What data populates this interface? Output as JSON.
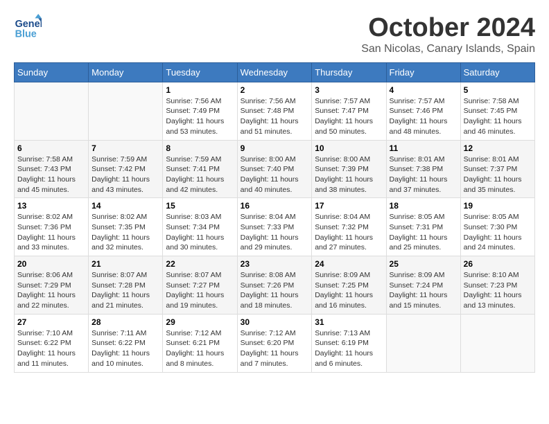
{
  "header": {
    "logo_line1": "General",
    "logo_line2": "Blue",
    "month": "October 2024",
    "location": "San Nicolas, Canary Islands, Spain"
  },
  "days_of_week": [
    "Sunday",
    "Monday",
    "Tuesday",
    "Wednesday",
    "Thursday",
    "Friday",
    "Saturday"
  ],
  "weeks": [
    [
      {
        "num": "",
        "info": ""
      },
      {
        "num": "",
        "info": ""
      },
      {
        "num": "1",
        "info": "Sunrise: 7:56 AM\nSunset: 7:49 PM\nDaylight: 11 hours and 53 minutes."
      },
      {
        "num": "2",
        "info": "Sunrise: 7:56 AM\nSunset: 7:48 PM\nDaylight: 11 hours and 51 minutes."
      },
      {
        "num": "3",
        "info": "Sunrise: 7:57 AM\nSunset: 7:47 PM\nDaylight: 11 hours and 50 minutes."
      },
      {
        "num": "4",
        "info": "Sunrise: 7:57 AM\nSunset: 7:46 PM\nDaylight: 11 hours and 48 minutes."
      },
      {
        "num": "5",
        "info": "Sunrise: 7:58 AM\nSunset: 7:45 PM\nDaylight: 11 hours and 46 minutes."
      }
    ],
    [
      {
        "num": "6",
        "info": "Sunrise: 7:58 AM\nSunset: 7:43 PM\nDaylight: 11 hours and 45 minutes."
      },
      {
        "num": "7",
        "info": "Sunrise: 7:59 AM\nSunset: 7:42 PM\nDaylight: 11 hours and 43 minutes."
      },
      {
        "num": "8",
        "info": "Sunrise: 7:59 AM\nSunset: 7:41 PM\nDaylight: 11 hours and 42 minutes."
      },
      {
        "num": "9",
        "info": "Sunrise: 8:00 AM\nSunset: 7:40 PM\nDaylight: 11 hours and 40 minutes."
      },
      {
        "num": "10",
        "info": "Sunrise: 8:00 AM\nSunset: 7:39 PM\nDaylight: 11 hours and 38 minutes."
      },
      {
        "num": "11",
        "info": "Sunrise: 8:01 AM\nSunset: 7:38 PM\nDaylight: 11 hours and 37 minutes."
      },
      {
        "num": "12",
        "info": "Sunrise: 8:01 AM\nSunset: 7:37 PM\nDaylight: 11 hours and 35 minutes."
      }
    ],
    [
      {
        "num": "13",
        "info": "Sunrise: 8:02 AM\nSunset: 7:36 PM\nDaylight: 11 hours and 33 minutes."
      },
      {
        "num": "14",
        "info": "Sunrise: 8:02 AM\nSunset: 7:35 PM\nDaylight: 11 hours and 32 minutes."
      },
      {
        "num": "15",
        "info": "Sunrise: 8:03 AM\nSunset: 7:34 PM\nDaylight: 11 hours and 30 minutes."
      },
      {
        "num": "16",
        "info": "Sunrise: 8:04 AM\nSunset: 7:33 PM\nDaylight: 11 hours and 29 minutes."
      },
      {
        "num": "17",
        "info": "Sunrise: 8:04 AM\nSunset: 7:32 PM\nDaylight: 11 hours and 27 minutes."
      },
      {
        "num": "18",
        "info": "Sunrise: 8:05 AM\nSunset: 7:31 PM\nDaylight: 11 hours and 25 minutes."
      },
      {
        "num": "19",
        "info": "Sunrise: 8:05 AM\nSunset: 7:30 PM\nDaylight: 11 hours and 24 minutes."
      }
    ],
    [
      {
        "num": "20",
        "info": "Sunrise: 8:06 AM\nSunset: 7:29 PM\nDaylight: 11 hours and 22 minutes."
      },
      {
        "num": "21",
        "info": "Sunrise: 8:07 AM\nSunset: 7:28 PM\nDaylight: 11 hours and 21 minutes."
      },
      {
        "num": "22",
        "info": "Sunrise: 8:07 AM\nSunset: 7:27 PM\nDaylight: 11 hours and 19 minutes."
      },
      {
        "num": "23",
        "info": "Sunrise: 8:08 AM\nSunset: 7:26 PM\nDaylight: 11 hours and 18 minutes."
      },
      {
        "num": "24",
        "info": "Sunrise: 8:09 AM\nSunset: 7:25 PM\nDaylight: 11 hours and 16 minutes."
      },
      {
        "num": "25",
        "info": "Sunrise: 8:09 AM\nSunset: 7:24 PM\nDaylight: 11 hours and 15 minutes."
      },
      {
        "num": "26",
        "info": "Sunrise: 8:10 AM\nSunset: 7:23 PM\nDaylight: 11 hours and 13 minutes."
      }
    ],
    [
      {
        "num": "27",
        "info": "Sunrise: 7:10 AM\nSunset: 6:22 PM\nDaylight: 11 hours and 11 minutes."
      },
      {
        "num": "28",
        "info": "Sunrise: 7:11 AM\nSunset: 6:22 PM\nDaylight: 11 hours and 10 minutes."
      },
      {
        "num": "29",
        "info": "Sunrise: 7:12 AM\nSunset: 6:21 PM\nDaylight: 11 hours and 8 minutes."
      },
      {
        "num": "30",
        "info": "Sunrise: 7:12 AM\nSunset: 6:20 PM\nDaylight: 11 hours and 7 minutes."
      },
      {
        "num": "31",
        "info": "Sunrise: 7:13 AM\nSunset: 6:19 PM\nDaylight: 11 hours and 6 minutes."
      },
      {
        "num": "",
        "info": ""
      },
      {
        "num": "",
        "info": ""
      }
    ]
  ]
}
